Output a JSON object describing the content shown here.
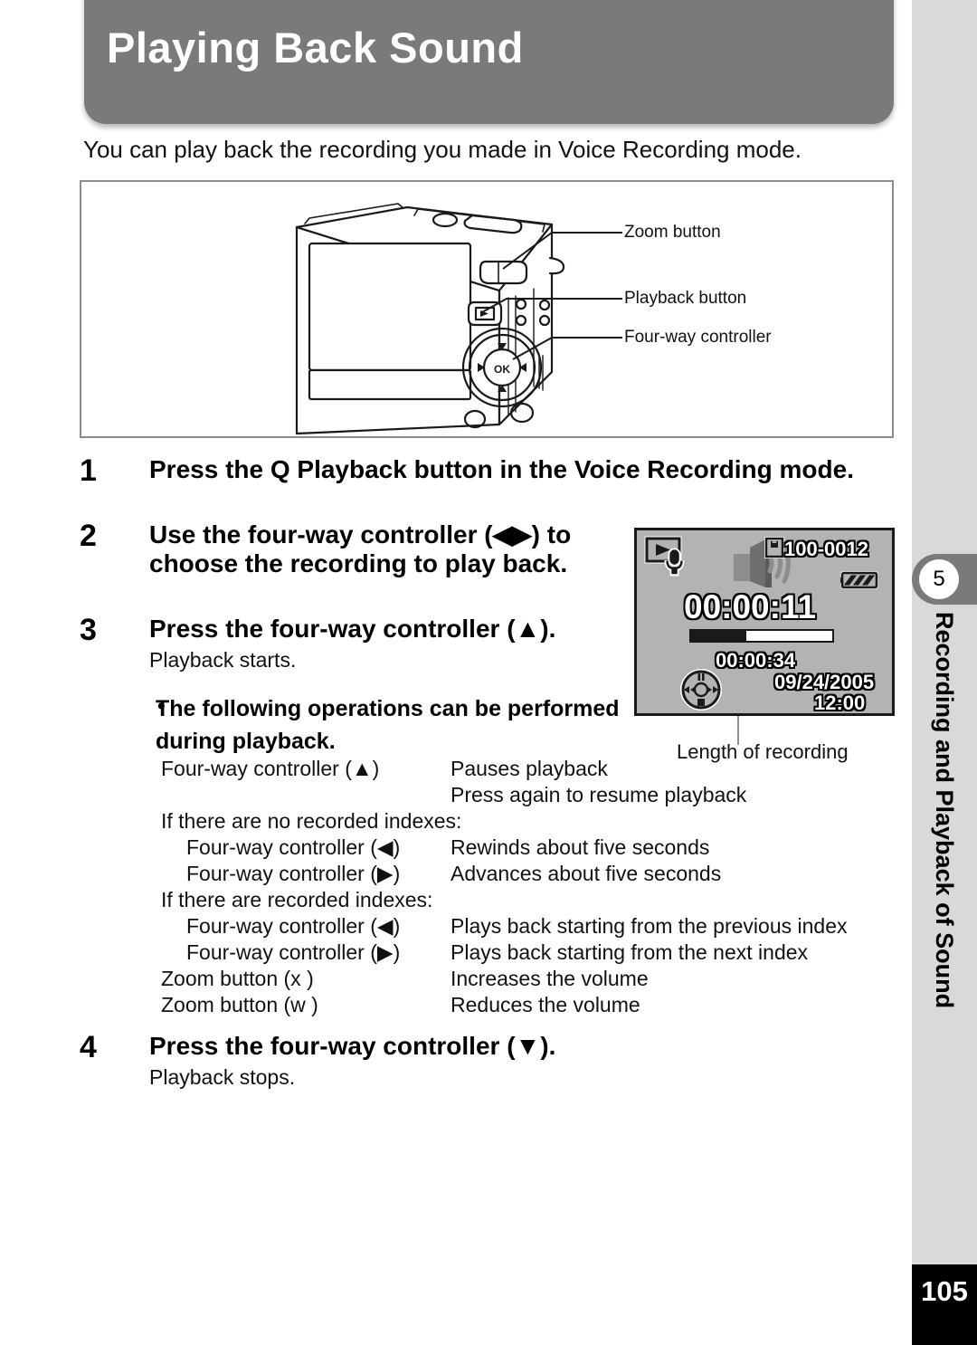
{
  "header": {
    "title": "Playing Back Sound"
  },
  "intro": "You can play back the recording you made in Voice Recording mode.",
  "figure": {
    "callouts": [
      {
        "name": "zoom-button",
        "label": "Zoom button"
      },
      {
        "name": "playback-button",
        "label": "Playback button"
      },
      {
        "name": "four-way-controller",
        "label": "Four-way controller"
      }
    ],
    "ok_button_label": "OK"
  },
  "steps": [
    {
      "num": "1",
      "text": "Press the Q  Playback button in the Voice Recording mode.",
      "sub": ""
    },
    {
      "num": "2",
      "text": "Use the four-way controller (◀▶) to choose the recording to play back.",
      "sub": ""
    },
    {
      "num": "3",
      "text": "Press the four-way controller (▲).",
      "sub": "Playback starts."
    },
    {
      "num": "4",
      "text": "Press the four-way controller (▼).",
      "sub": "Playback stops."
    }
  ],
  "bullet": {
    "marker": "•",
    "text": "The following operations can be performed during playback."
  },
  "operations": [
    {
      "type": "pair",
      "key": "Four-way controller (▲)",
      "value": "Pauses playback",
      "indent": false
    },
    {
      "type": "pair",
      "key": "",
      "value": "Press again to resume playback",
      "indent": false
    },
    {
      "type": "plain",
      "key": "If there are no recorded indexes:",
      "value": "",
      "indent": false
    },
    {
      "type": "pair",
      "key": "Four-way controller (◀)",
      "value": "Rewinds about five seconds",
      "indent": true
    },
    {
      "type": "pair",
      "key": "Four-way controller (▶)",
      "value": "Advances about five seconds",
      "indent": true
    },
    {
      "type": "plain",
      "key": "If there are recorded indexes:",
      "value": "",
      "indent": false
    },
    {
      "type": "pair",
      "key": "Four-way controller (◀)",
      "value": "Plays back starting from the previous index",
      "indent": true
    },
    {
      "type": "pair",
      "key": "Four-way controller (▶)",
      "value": "Plays back starting from the next index",
      "indent": true
    },
    {
      "type": "pair",
      "key": "Zoom button (x )",
      "value": "Increases the volume",
      "indent": false
    },
    {
      "type": "pair",
      "key": "Zoom button (w )",
      "value": "Reduces the volume",
      "indent": false
    }
  ],
  "lcd": {
    "mode_icon": "playback-voice-icon",
    "speaker_icon": "speaker-icon",
    "card_icon": "sd-card-icon",
    "battery_icon": "battery-icon",
    "four_way_icon": "four-way-guide-icon",
    "file_number": "100-0012",
    "elapsed_time": "00:00:11",
    "recording_length": "00:00:34",
    "date": "09/24/2005",
    "clock": "12:00",
    "progress_percent": 39,
    "caption": "Length of recording"
  },
  "sidebar": {
    "chapter_number": "5",
    "chapter_title": "Recording and Playback of Sound"
  },
  "page_number": "105",
  "colors": {
    "header_gray": "#7a7a7c",
    "sidebar_gray": "#d9d9d9",
    "tab_gray": "#7a7a7c",
    "lcd_gray": "#b3b3b3",
    "page_box": "#000000"
  }
}
